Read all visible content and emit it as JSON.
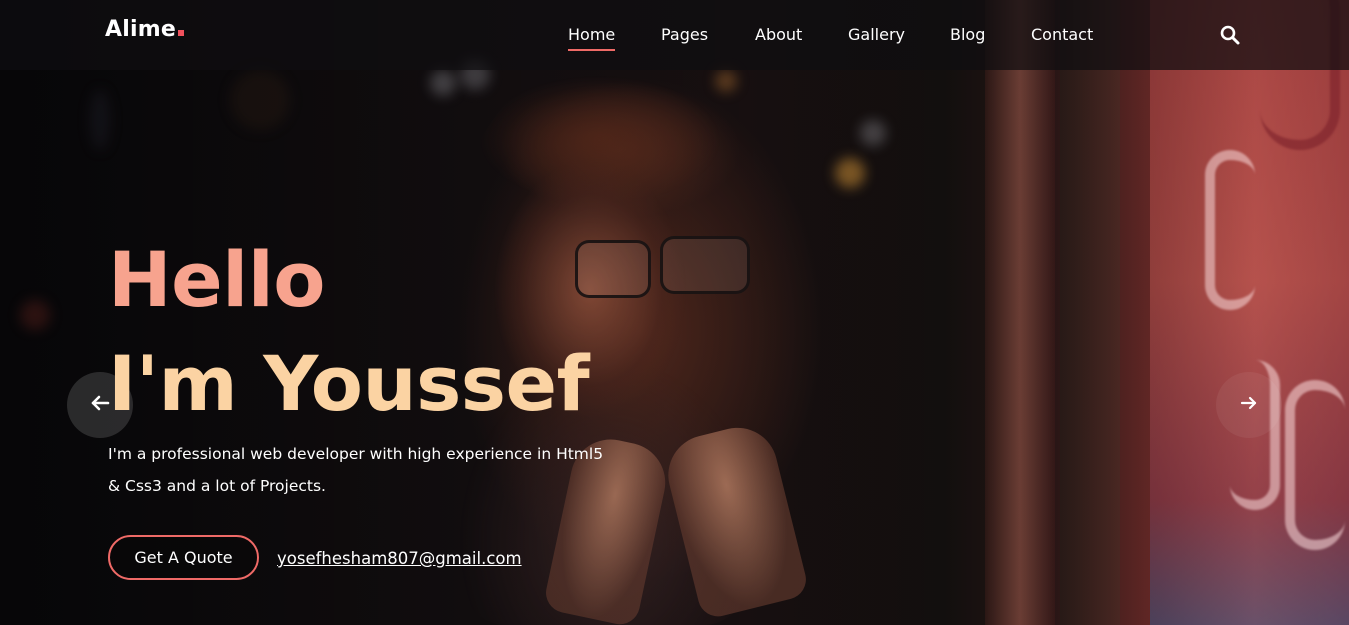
{
  "brand": {
    "name": "Alime",
    "accent_color": "#f0525d"
  },
  "nav": {
    "items": [
      {
        "label": "Home",
        "active": true
      },
      {
        "label": "Pages",
        "active": false
      },
      {
        "label": "About",
        "active": false
      },
      {
        "label": "Gallery",
        "active": false
      },
      {
        "label": "Blog",
        "active": false
      },
      {
        "label": "Contact",
        "active": false
      }
    ],
    "search_icon": "search-icon"
  },
  "hero": {
    "headline_line1": "Hello",
    "headline_line2": "I'm Youssef",
    "description_line1": "I'm a professional web developer with high experience in Html5",
    "description_line2": "& Css3 and a lot of Projects.",
    "cta_label": "Get A Quote",
    "email": "yosefhesham807@gmail.com",
    "headline_color_1": "#f7a38e",
    "headline_color_2": "#fbd3a3",
    "button_border_color": "#ef6a67"
  },
  "carousel": {
    "prev_icon": "arrow-left-icon",
    "next_icon": "arrow-right-icon"
  }
}
